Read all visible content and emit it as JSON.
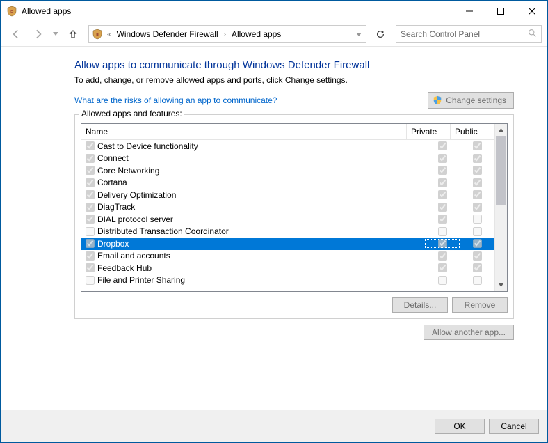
{
  "window": {
    "title": "Allowed apps"
  },
  "nav": {
    "breadcrumb": [
      "Windows Defender Firewall",
      "Allowed apps"
    ],
    "search_placeholder": "Search Control Panel"
  },
  "page": {
    "heading": "Allow apps to communicate through Windows Defender Firewall",
    "subheading": "To add, change, or remove allowed apps and ports, click Change settings.",
    "risk_link": "What are the risks of allowing an app to communicate?",
    "change_settings_label": "Change settings",
    "group_legend": "Allowed apps and features:",
    "col_name": "Name",
    "col_private": "Private",
    "col_public": "Public",
    "details_label": "Details...",
    "remove_label": "Remove",
    "allow_another_label": "Allow another app...",
    "ok_label": "OK",
    "cancel_label": "Cancel"
  },
  "apps": [
    {
      "enabled": true,
      "name": "Cast to Device functionality",
      "private": true,
      "public": true,
      "selected": false
    },
    {
      "enabled": true,
      "name": "Connect",
      "private": true,
      "public": true,
      "selected": false
    },
    {
      "enabled": true,
      "name": "Core Networking",
      "private": true,
      "public": true,
      "selected": false
    },
    {
      "enabled": true,
      "name": "Cortana",
      "private": true,
      "public": true,
      "selected": false
    },
    {
      "enabled": true,
      "name": "Delivery Optimization",
      "private": true,
      "public": true,
      "selected": false
    },
    {
      "enabled": true,
      "name": "DiagTrack",
      "private": true,
      "public": true,
      "selected": false
    },
    {
      "enabled": true,
      "name": "DIAL protocol server",
      "private": true,
      "public": false,
      "selected": false
    },
    {
      "enabled": false,
      "name": "Distributed Transaction Coordinator",
      "private": false,
      "public": false,
      "selected": false
    },
    {
      "enabled": true,
      "name": "Dropbox",
      "private": true,
      "public": true,
      "selected": true
    },
    {
      "enabled": true,
      "name": "Email and accounts",
      "private": true,
      "public": true,
      "selected": false
    },
    {
      "enabled": true,
      "name": "Feedback Hub",
      "private": true,
      "public": true,
      "selected": false
    },
    {
      "enabled": false,
      "name": "File and Printer Sharing",
      "private": false,
      "public": false,
      "selected": false
    }
  ]
}
